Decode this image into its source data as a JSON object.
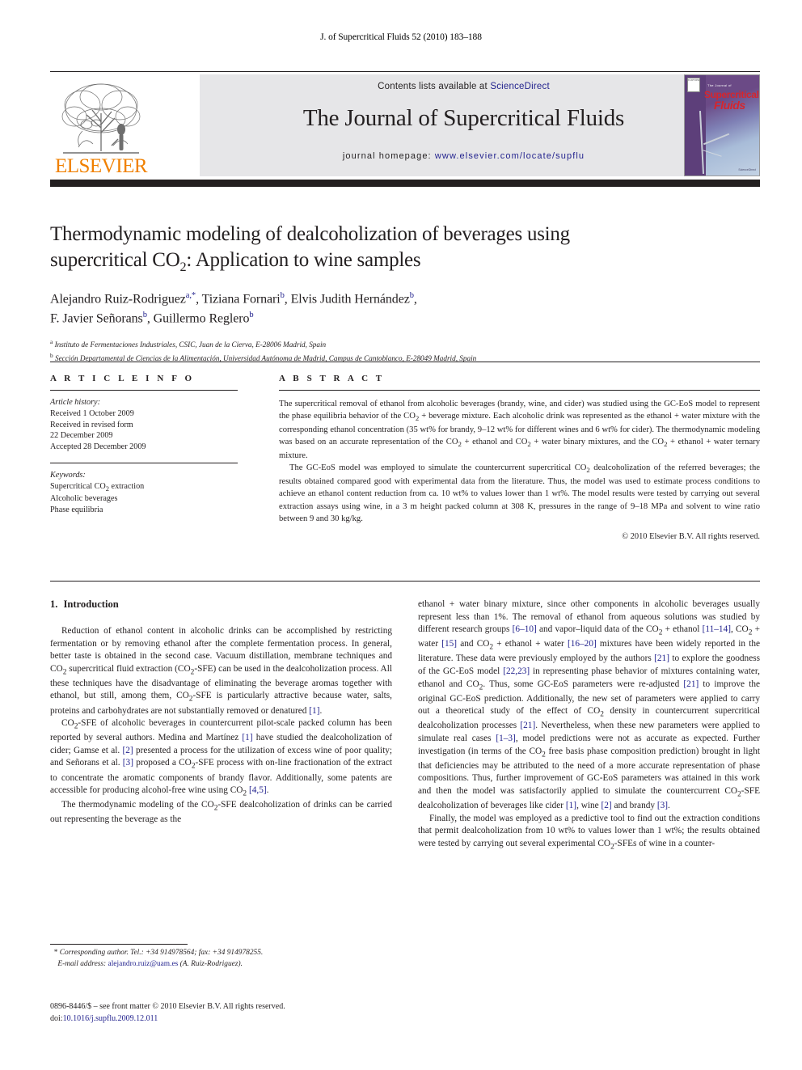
{
  "running_head": "J. of Supercritical Fluids 52 (2010) 183–188",
  "masthead": {
    "contents_prefix": "Contents lists available at ",
    "sciencedirect": "ScienceDirect",
    "journal_title": "The Journal of Supercritical Fluids",
    "homepage_prefix": "journal homepage: ",
    "homepage_url": "www.elsevier.com/locate/supflu",
    "elsevier_wordmark": "ELSEVIER",
    "elsevier_color": "#f08000",
    "cover": {
      "publisher": "ELSEVIER",
      "kicker": "The Journal of",
      "line1": "Supercritical",
      "line2": "Fluids",
      "footer": "ScienceDirect",
      "title_color": "#d6252c"
    },
    "link_color": "#23238e",
    "band_color": "#e6e6e8"
  },
  "article": {
    "title_line1": "Thermodynamic modeling of dealcoholization of beverages using",
    "title_line2_a": "supercritical CO",
    "title_line2_sub": "2",
    "title_line2_b": ": Application to wine samples",
    "authors_line1": "Alejandro Ruiz-Rodriguez",
    "authors_line1_sup": "a,*",
    "authors_line1_b": ", Tiziana Fornari",
    "authors_line1_sup2": "b",
    "authors_line1_c": ", Elvis Judith Hernández",
    "authors_line1_sup3": "b",
    "authors_line1_d": ",",
    "authors_line2": "F. Javier Señorans",
    "authors_line2_sup": "b",
    "authors_line2_b": ", Guillermo Reglero",
    "authors_line2_sup2": "b",
    "affiliation_a_sup": "a",
    "affiliation_a": " Instituto de Fermentaciones Industriales, CSIC, Juan de la Cierva, E-28006 Madrid, Spain",
    "affiliation_b_sup": "b",
    "affiliation_b": " Sección Departamental de Ciencias de la Alimentación, Universidad Autónoma de Madrid, Campus de Cantoblanco, E-28049 Madrid, Spain"
  },
  "article_info": {
    "heading": "A R T I C L E    I N F O",
    "history_label": "Article history:",
    "history": [
      "Received 1 October 2009",
      "Received in revised form",
      "22 December 2009",
      "Accepted 28 December 2009"
    ],
    "keywords_label": "Keywords:",
    "keywords_1a": "Supercritical CO",
    "keywords_1sub": "2",
    "keywords_1b": " extraction",
    "keywords_2": "Alcoholic beverages",
    "keywords_3": "Phase equilibria"
  },
  "abstract": {
    "heading": "A B S T R A C T",
    "p1_part1": "The supercritical removal of ethanol from alcoholic beverages (brandy, wine, and cider) was studied using the GC-EoS model to represent the phase equilibria behavior of the CO",
    "p1_sub1": "2",
    "p1_part2": " + beverage mixture. Each alcoholic drink was represented as the ethanol + water mixture with the corresponding ethanol concentration (35 wt% for brandy, 9–12 wt% for different wines and 6 wt% for cider). The thermodynamic modeling was based on an accurate representation of the CO",
    "p1_sub2": "2",
    "p1_part3": " + ethanol and CO",
    "p1_sub3": "2",
    "p1_part4": " + water binary mixtures, and the CO",
    "p1_sub4": "2",
    "p1_part5": " + ethanol + water ternary mixture.",
    "p2_part1": "The GC-EoS model was employed to simulate the countercurrent supercritical CO",
    "p2_sub1": "2",
    "p2_part2": " dealcoholization of the referred beverages; the results obtained compared good with experimental data from the literature. Thus, the model was used to estimate process conditions to achieve an ethanol content reduction from ca. 10 wt% to values lower than 1 wt%. The model results were tested by carrying out several extraction assays using wine, in a 3 m height packed column at 308 K, pressures in the range of 9–18 MPa and solvent to wine ratio between 9 and 30 kg/kg.",
    "copyright": "© 2010 Elsevier B.V. All rights reserved."
  },
  "introduction": {
    "number": "1.",
    "heading": "Introduction",
    "left": {
      "p1_a": "Reduction of ethanol content in alcoholic drinks can be accomplished by restricting fermentation or by removing ethanol after the complete fermentation process. In general, better taste is obtained in the second case. Vacuum distillation, membrane techniques and CO",
      "p1_sub1": "2",
      "p1_b": " supercritical fluid extraction (CO",
      "p1_sub2": "2",
      "p1_c": "-SFE) can be used in the dealcoholization process. All these techniques have the disadvantage of eliminating the beverage aromas together with ethanol, but still, among them, CO",
      "p1_sub3": "2",
      "p1_d": "-SFE is particularly attractive because water, salts, proteins and carbohydrates are not substantially removed or denatured ",
      "p1_ref1": "[1]",
      "p1_e": ".",
      "p2_a": "CO",
      "p2_sub1": "2",
      "p2_b": "-SFE of alcoholic beverages in countercurrent pilot-scale packed column has been reported by several authors. Medina and Martínez ",
      "p2_ref1": "[1]",
      "p2_c": " have studied the dealcoholization of cider; Gamse et al. ",
      "p2_ref2": "[2]",
      "p2_d": " presented a process for the utilization of excess wine of poor quality; and Señorans et al. ",
      "p2_ref3": "[3]",
      "p2_e": " proposed a CO",
      "p2_sub2": "2",
      "p2_f": "-SFE process with on-line fractionation of the extract to concentrate the aromatic components of brandy flavor. Additionally, some patents are accessible for producing alcohol-free wine using CO",
      "p2_sub3": "2",
      "p2_g": " ",
      "p2_ref4": "[4,5]",
      "p2_h": ".",
      "p3_a": "The thermodynamic modeling of the CO",
      "p3_sub1": "2",
      "p3_b": "-SFE dealcoholization of drinks can be carried out representing the beverage as the"
    },
    "right": {
      "p1_a": "ethanol + water binary mixture, since other components in alcoholic beverages usually represent less than 1%. The removal of ethanol from aqueous solutions was studied by different research groups ",
      "p1_ref1": "[6–10]",
      "p1_b": " and vapor–liquid data of the CO",
      "p1_sub1": "2",
      "p1_c": " + ethanol ",
      "p1_ref2": "[11–14]",
      "p1_d": ", CO",
      "p1_sub2": "2",
      "p1_e": " + water ",
      "p1_ref3": "[15]",
      "p1_f": " and CO",
      "p1_sub3": "2",
      "p1_g": " + ethanol + water ",
      "p1_ref4": "[16–20]",
      "p1_h": " mixtures have been widely reported in the literature. These data were previously employed by the authors ",
      "p1_ref5": "[21]",
      "p1_i": " to explore the goodness of the GC-EoS model ",
      "p1_ref6": "[22,23]",
      "p1_j": " in representing phase behavior of mixtures containing water, ethanol and CO",
      "p1_sub4": "2",
      "p1_k": ". Thus, some GC-EoS parameters were re-adjusted ",
      "p1_ref7": "[21]",
      "p1_l": " to improve the original GC-EoS prediction. Additionally, the new set of parameters were applied to carry out a theoretical study of the effect of CO",
      "p1_sub5": "2",
      "p1_m": " density in countercurrent supercritical dealcoholization processes ",
      "p1_ref8": "[21]",
      "p1_n": ". Nevertheless, when these new parameters were applied to simulate real cases ",
      "p1_ref9": "[1–3]",
      "p1_o": ", model predictions were not as accurate as expected. Further investigation (in terms of the CO",
      "p1_sub6": "2",
      "p1_p": " free basis phase composition prediction) brought in light that deficiencies may be attributed to the need of a more accurate representation of phase compositions. Thus, further improvement of GC-EoS parameters was attained in this work and then the model was satisfactorily applied to simulate the countercurrent CO",
      "p1_sub7": "2",
      "p1_q": "-SFE dealcoholization of beverages like cider ",
      "p1_ref10": "[1]",
      "p1_r": ", wine ",
      "p1_ref11": "[2]",
      "p1_s": " and brandy ",
      "p1_ref12": "[3]",
      "p1_t": ".",
      "p2_a": "Finally, the model was employed as a predictive tool to find out the extraction conditions that permit dealcoholization from 10 wt% to values lower than 1 wt%; the results obtained were tested by carrying out several experimental CO",
      "p2_sub1": "2",
      "p2_b": "-SFEs of wine in a counter-"
    }
  },
  "footnote": {
    "star": "*",
    "corresponding": " Corresponding author. Tel.: +34 914978564; fax: +34 914978255.",
    "email_label": "E-mail address:",
    "email": "alejandro.ruiz@uam.es",
    "email_owner": " (A. Ruiz-Rodriguez)."
  },
  "imprint": {
    "issn_line": "0896-8446/$ – see front matter © 2010 Elsevier B.V. All rights reserved.",
    "doi_label": "doi:",
    "doi": "10.1016/j.supflu.2009.12.011"
  }
}
